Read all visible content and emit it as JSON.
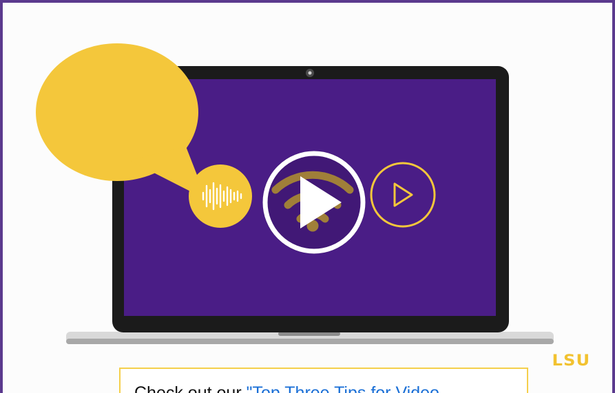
{
  "brand": {
    "logo_text": "LSU",
    "accent_gold": "#f2c230",
    "accent_purple": "#4a1d86",
    "border_purple": "#5b3a8e"
  },
  "video": {
    "play_button_label": "Play video",
    "icons": [
      "speech-bubble-icon",
      "audio-waveform-icon",
      "wifi-icon",
      "play-circle-icon",
      "webcam-icon"
    ]
  },
  "callout": {
    "prefix": "Check out our ",
    "link_text": "\"Top Three Tips for Video"
  }
}
